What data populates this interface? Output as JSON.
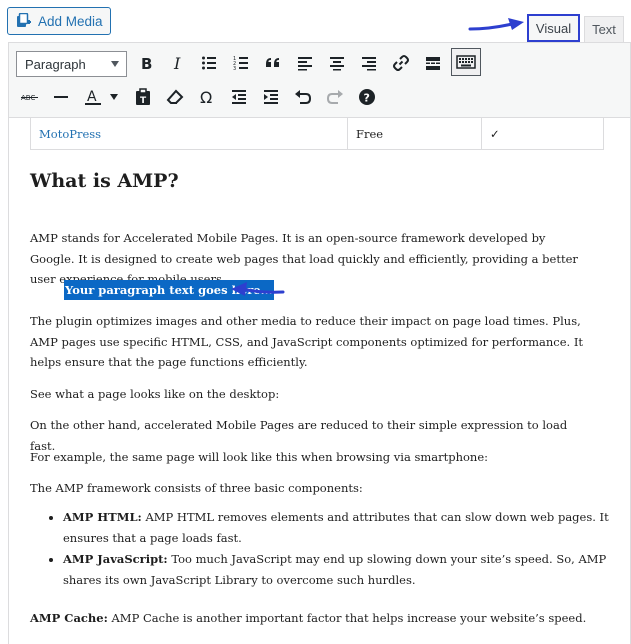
{
  "toolbar": {
    "add_media_label": "Add Media",
    "format_value": "Paragraph",
    "tabs": {
      "visual": "Visual",
      "text": "Text"
    }
  },
  "table_row": {
    "plugin": "MotoPress",
    "price": "Free",
    "check": "✓"
  },
  "content": {
    "heading": "What is AMP?",
    "p1": "AMP stands for Accelerated Mobile Pages. It is an open-source framework developed by Google. It is designed to create web pages that load quickly and efficiently, providing a better user experience for mobile users.",
    "highlight": "Your paragraph text goes here...",
    "p2": "The plugin optimizes images and other media to reduce their impact on page load times. Plus, AMP pages use specific HTML, CSS, and JavaScript components optimized for performance. It helps ensure that the page functions efficiently.",
    "p3": "See what a page looks like on the desktop:",
    "p4": "On the other hand, accelerated Mobile Pages are reduced to their simple expression to load fast.",
    "p5": "For example, the same page will look like this when browsing via smartphone:",
    "p6": "The AMP framework consists of three basic components:",
    "list": [
      {
        "term": "AMP HTML:",
        "text": " AMP HTML removes elements and attributes that can slow down web pages. It ensures that a page loads fast."
      },
      {
        "term": "AMP JavaScript:",
        "text": " Too much JavaScript may end up slowing down your site’s speed. So, AMP shares its own JavaScript Library to overcome such hurdles."
      }
    ],
    "cache_term": "AMP Cache:",
    "cache_text": " AMP Cache is another important factor that helps increase your website’s speed."
  },
  "colors": {
    "accent": "#2271b1",
    "highlight": "#0b68c5",
    "annotation": "#2d3fcf"
  }
}
